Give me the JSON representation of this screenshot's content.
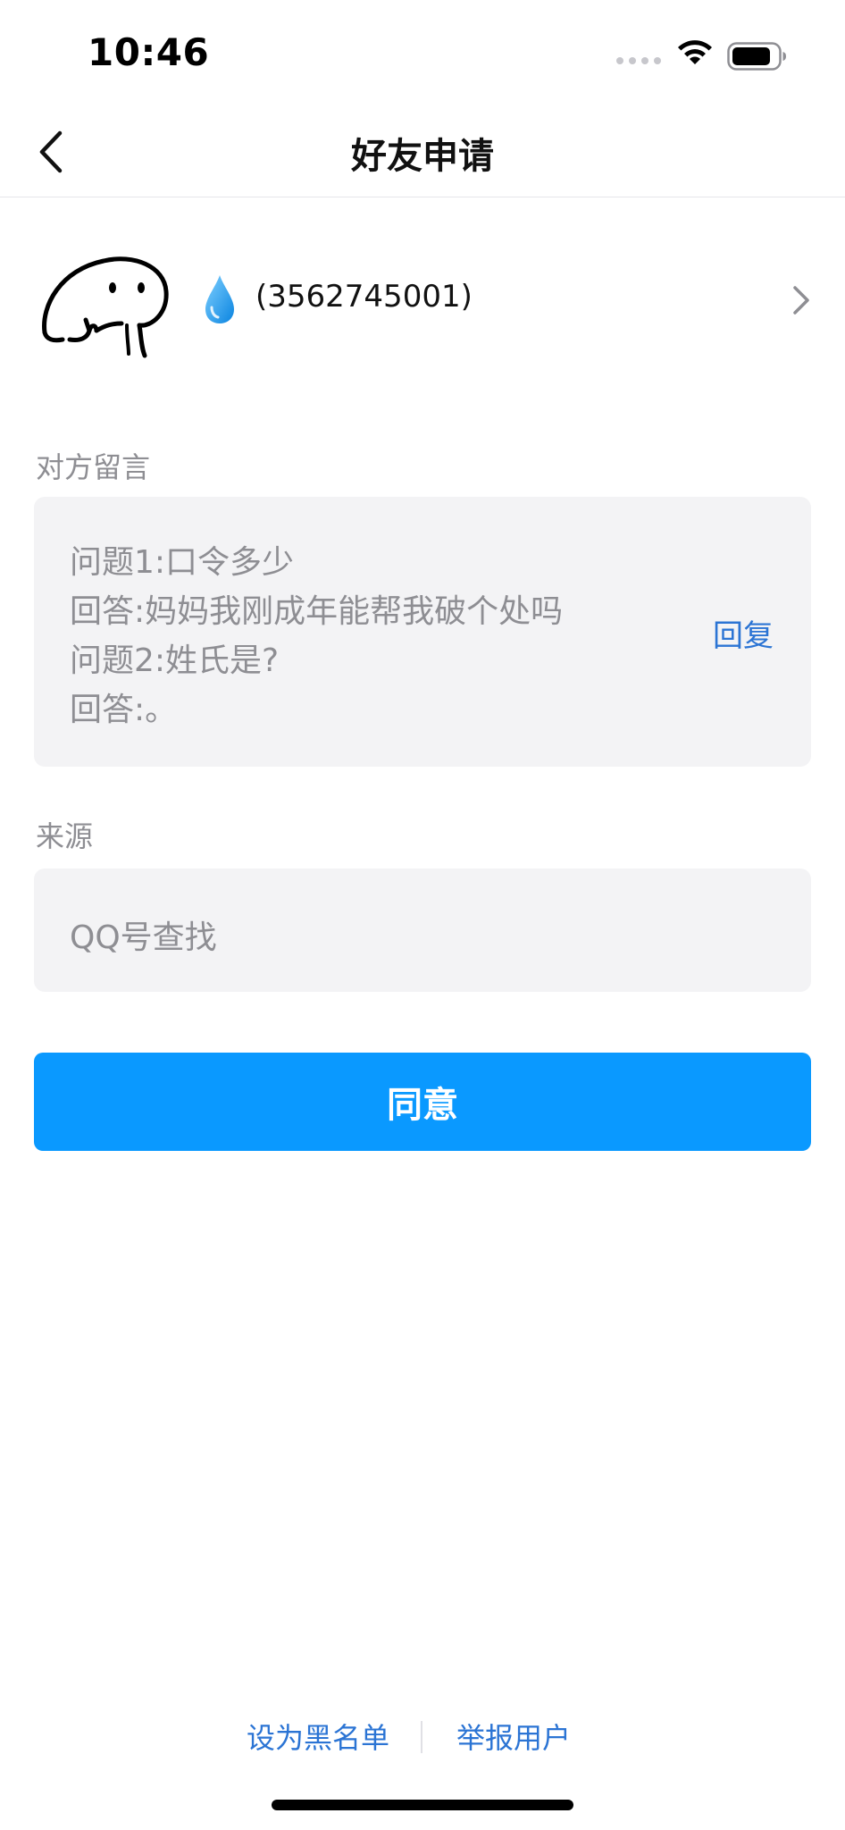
{
  "status_bar": {
    "time": "10:46"
  },
  "nav": {
    "title": "好友申请",
    "back_icon": "chevron-left-icon"
  },
  "profile": {
    "avatar_icon": "avatar",
    "emoji_icon": "droplet-icon",
    "name": "(3562745001)",
    "chevron_icon": "chevron-right-icon"
  },
  "message_section": {
    "label": "对方留言",
    "lines": [
      "问题1:口令多少",
      "回答:妈妈我刚成年能帮我破个处吗",
      "问题2:姓氏是?",
      "回答:。"
    ],
    "reply_label": "回复"
  },
  "source_section": {
    "label": "来源",
    "value": "QQ号查找"
  },
  "actions": {
    "agree_label": "同意"
  },
  "footer": {
    "blacklist_label": "设为黑名单",
    "report_label": "举报用户"
  },
  "colors": {
    "accent": "#0a99ff",
    "link": "#2b74d4",
    "muted_text": "#8e8e93",
    "panel_bg": "#f3f3f5"
  }
}
